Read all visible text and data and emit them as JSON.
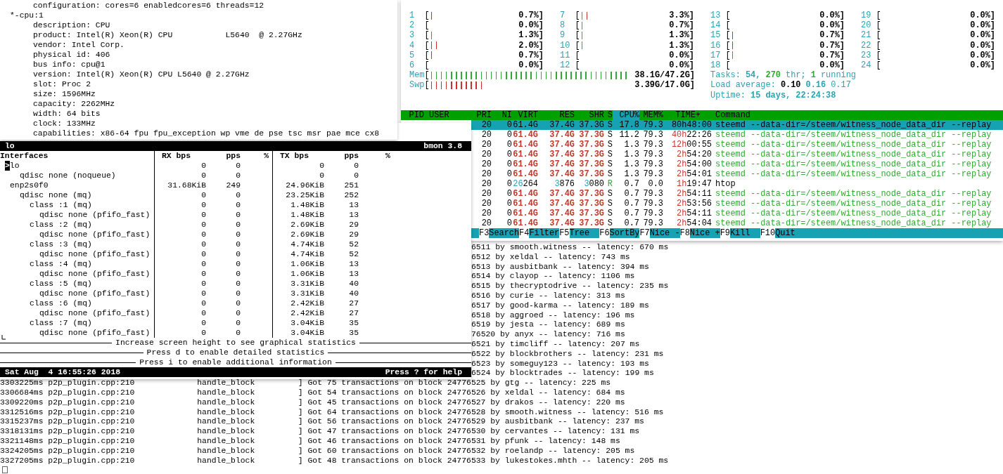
{
  "lshw": {
    "leading_line": "configuration: cores=6 enabledcores=6 threads=12",
    "node": {
      "name": "*-cpu:1",
      "properties": [
        "description: CPU",
        "product: Intel(R) Xeon(R) CPU           L5640  @ 2.27GHz",
        "vendor: Intel Corp.",
        "physical id: 406",
        "bus info: cpu@1",
        "version: Intel(R) Xeon(R) CPU L5640 @ 2.27GHz",
        "slot: Proc 2",
        "size: 1596MHz",
        "capacity: 2262MHz",
        "width: 64 bits",
        "clock: 133MHz",
        "capabilities: x86-64 fpu fpu_exception wp vme de pse tsc msr pae mce cx8"
      ]
    }
  },
  "htop": {
    "cpu_columns": [
      [
        {
          "label": "1",
          "open": "[",
          "ticks": [
            {
              "color": "#c83232"
            }
          ],
          "value": "0.7%]"
        },
        {
          "label": "2",
          "open": "[",
          "value": "0.0%]"
        },
        {
          "label": "3",
          "open": "[",
          "ticks": [
            {
              "color": "#34a834"
            }
          ],
          "value": "1.3%]"
        },
        {
          "label": "4",
          "open": "[",
          "ticks": [
            {
              "color": "#c83232"
            },
            {
              "color": "#c83232"
            }
          ],
          "value": "2.0%]"
        },
        {
          "label": "5",
          "open": "[",
          "ticks": [
            {
              "color": "#c83232"
            }
          ],
          "value": "0.7%]"
        },
        {
          "label": "6",
          "open": "[",
          "value": "0.0%]"
        }
      ],
      [
        {
          "label": "7",
          "open": "[",
          "ticks": [
            {
              "color": "#34a834"
            },
            {
              "color": "#c83232"
            }
          ],
          "value": "3.3%]"
        },
        {
          "label": "8",
          "open": "[",
          "ticks": [
            {
              "color": "#34a834"
            }
          ],
          "value": "0.7%]"
        },
        {
          "label": "9",
          "open": "[",
          "ticks": [
            {
              "color": "#34a834"
            }
          ],
          "value": "1.3%]"
        },
        {
          "label": "10",
          "open": "[",
          "ticks": [
            {
              "color": "#34a834"
            }
          ],
          "value": "1.3%]"
        },
        {
          "label": "11",
          "open": "[",
          "value": "0.0%]"
        },
        {
          "label": "12",
          "open": "[",
          "value": "0.0%]"
        }
      ],
      [
        {
          "label": "13",
          "open": "[",
          "value": "0.0%]"
        },
        {
          "label": "14",
          "open": "[",
          "value": "0.0%]"
        },
        {
          "label": "15",
          "open": "[",
          "ticks": [
            {
              "color": "#c83232"
            }
          ],
          "value": "0.7%]"
        },
        {
          "label": "16",
          "open": "[",
          "ticks": [
            {
              "color": "#c83232"
            }
          ],
          "value": "0.7%]"
        },
        {
          "label": "17",
          "open": "[",
          "ticks": [
            {
              "color": "#34a834"
            }
          ],
          "value": "0.7%]"
        },
        {
          "label": "18",
          "open": "[",
          "value": "0.0%]"
        }
      ],
      [
        {
          "label": "19",
          "open": "[",
          "value": "0.0%]"
        },
        {
          "label": "20",
          "open": "[",
          "value": "0.0%]"
        },
        {
          "label": "21",
          "open": "[",
          "value": "0.0%]"
        },
        {
          "label": "22",
          "open": "[",
          "value": "0.0%]"
        },
        {
          "label": "23",
          "open": "[",
          "value": "0.0%]"
        },
        {
          "label": "24",
          "open": "[",
          "value": "0.0%]"
        }
      ]
    ],
    "memory": [
      {
        "label": "Mem",
        "open": "[",
        "ticks": [
          {
            "color": "#34a834"
          },
          {
            "color": "#34a834"
          },
          {
            "color": "#34a834"
          },
          {
            "color": "#34a834"
          },
          {
            "color": "#34a834"
          },
          {
            "color": "#34a834"
          },
          {
            "color": "#34a834"
          },
          {
            "color": "#34a834"
          },
          {
            "color": "#34a834"
          },
          {
            "color": "#34a834"
          },
          {
            "color": "#34a834"
          },
          {
            "color": "#34a834"
          },
          {
            "color": "#34a834"
          },
          {
            "color": "#34a834"
          },
          {
            "color": "#34a834"
          },
          {
            "color": "#34a834"
          },
          {
            "color": "#34a834"
          },
          {
            "color": "#34a834"
          },
          {
            "color": "#34a834"
          },
          {
            "color": "#34a834"
          },
          {
            "color": "#34a834"
          },
          {
            "color": "#34a834"
          },
          {
            "color": "#34a834"
          },
          {
            "color": "#34a834"
          },
          {
            "color": "#34a834"
          },
          {
            "color": "#34a834"
          },
          {
            "color": "#34a834"
          },
          {
            "color": "#34a834"
          },
          {
            "color": "#34a834"
          },
          {
            "color": "#34a834"
          },
          {
            "color": "#34a834"
          },
          {
            "color": "#34a834"
          },
          {
            "color": "#34a834"
          },
          {
            "color": "#34a834"
          },
          {
            "color": "#34a834"
          },
          {
            "color": "#34a834"
          },
          {
            "color": "#34a834"
          },
          {
            "color": "#34a834"
          },
          {
            "color": "#34a834"
          },
          {
            "color": "#34a834"
          }
        ],
        "value": "38.1G/47.2G]"
      },
      {
        "label": "Swp",
        "open": "[",
        "ticks": [
          {
            "color": "#c83232"
          },
          {
            "color": "#c83232"
          },
          {
            "color": "#c83232"
          },
          {
            "color": "#c83232"
          },
          {
            "color": "#c83232"
          },
          {
            "color": "#c83232"
          },
          {
            "color": "#c83232"
          },
          {
            "color": "#c83232"
          },
          {
            "color": "#c83232"
          },
          {
            "color": "#c83232"
          },
          {
            "color": "#c83232"
          }
        ],
        "value": "3.39G/17.0G]"
      }
    ],
    "info": [
      [
        {
          "text": "Tasks:",
          "kind": "label"
        },
        {
          "text": "54,",
          "kind": "value"
        },
        {
          "text": "270",
          "kind": "highlight"
        },
        {
          "text": "thr;",
          "kind": "label"
        },
        {
          "text": "1",
          "kind": "highlight"
        },
        {
          "text": "running",
          "kind": "label"
        }
      ],
      [
        {
          "text": "Load average:",
          "kind": "label"
        },
        {
          "text": "0.10",
          "kind": "strong"
        },
        {
          "text": "0.16",
          "kind": "value"
        },
        {
          "text": "0.17",
          "kind": "label"
        }
      ],
      [
        {
          "text": "Uptime:",
          "kind": "label"
        },
        {
          "text": "15 days, 22:24:38",
          "kind": "value"
        }
      ]
    ],
    "columns": [
      {
        "label": "PID",
        "sorted": false
      },
      {
        "label": "USER",
        "sorted": false
      },
      {
        "label": "PRI",
        "sorted": false
      },
      {
        "label": "NI",
        "sorted": false
      },
      {
        "label": "VIRT",
        "sorted": false
      },
      {
        "label": "RES",
        "sorted": false
      },
      {
        "label": "SHR",
        "sorted": false
      },
      {
        "label": "S",
        "sorted": false
      },
      {
        "label": "CPU%",
        "sorted": true
      },
      {
        "label": "MEM%",
        "sorted": false
      },
      {
        "label": "TIME+",
        "sorted": false
      },
      {
        "label": "Command",
        "sorted": false
      }
    ],
    "processes": [
      {
        "selected": true,
        "kind": "thread",
        "large_memory": true,
        "running": false,
        "pri": "20",
        "ni": "0",
        "virt": {
          "hi": "61.4G"
        },
        "res": {
          "hi": "37.4G"
        },
        "shr": {
          "hi": "37.3G"
        },
        "state": "S",
        "cpu": "17.8",
        "mem": "79.3",
        "time": {
          "hi": "80h",
          "lo": "48:00"
        },
        "command": "steemd --data-dir=/steem/witness_node_data_dir --replay"
      },
      {
        "selected": false,
        "kind": "thread",
        "large_memory": true,
        "running": false,
        "pri": "20",
        "ni": "0",
        "virt": {
          "hi": "61.4G"
        },
        "res": {
          "hi": "37.4G"
        },
        "shr": {
          "hi": "37.3G"
        },
        "state": "S",
        "cpu": "11.2",
        "mem": "79.3",
        "time": {
          "hi": "40h",
          "lo": "22:26"
        },
        "command": "steemd --data-dir=/steem/witness_node_data_dir --replay"
      },
      {
        "selected": false,
        "kind": "thread",
        "large_memory": true,
        "running": false,
        "pri": "20",
        "ni": "0",
        "virt": {
          "hi": "61.4G"
        },
        "res": {
          "hi": "37.4G"
        },
        "shr": {
          "hi": "37.3G"
        },
        "state": "S",
        "cpu": "1.3",
        "mem": "79.3",
        "time": {
          "hi": "12h",
          "lo": "00:55"
        },
        "command": "steemd --data-dir=/steem/witness_node_data_dir --replay"
      },
      {
        "selected": false,
        "kind": "thread",
        "large_memory": true,
        "running": false,
        "pri": "20",
        "ni": "0",
        "virt": {
          "hi": "61.4G"
        },
        "res": {
          "hi": "37.4G"
        },
        "shr": {
          "hi": "37.3G"
        },
        "state": "S",
        "cpu": "1.3",
        "mem": "79.3",
        "time": {
          "hi": "2h",
          "lo": "54:20"
        },
        "command": "steemd --data-dir=/steem/witness_node_data_dir --replay"
      },
      {
        "selected": false,
        "kind": "thread",
        "large_memory": true,
        "running": false,
        "pri": "20",
        "ni": "0",
        "virt": {
          "hi": "61.4G"
        },
        "res": {
          "hi": "37.4G"
        },
        "shr": {
          "hi": "37.3G"
        },
        "state": "S",
        "cpu": "1.3",
        "mem": "79.3",
        "time": {
          "hi": "2h",
          "lo": "54:00"
        },
        "command": "steemd --data-dir=/steem/witness_node_data_dir --replay"
      },
      {
        "selected": false,
        "kind": "thread",
        "large_memory": true,
        "running": false,
        "pri": "20",
        "ni": "0",
        "virt": {
          "hi": "61.4G"
        },
        "res": {
          "hi": "37.4G"
        },
        "shr": {
          "hi": "37.3G"
        },
        "state": "S",
        "cpu": "1.3",
        "mem": "79.3",
        "time": {
          "hi": "2h",
          "lo": "54:01"
        },
        "command": "steemd --data-dir=/steem/witness_node_data_dir --replay"
      },
      {
        "selected": false,
        "kind": "process",
        "large_memory": false,
        "running": true,
        "pri": "20",
        "ni": "0",
        "virt": {
          "hi": "26",
          "lo": "264"
        },
        "res": {
          "hi": "3",
          "lo": "876"
        },
        "shr": {
          "hi": "3",
          "lo": "080"
        },
        "state": "R",
        "cpu": "0.7",
        "mem": "0.0",
        "time": {
          "hi": "1h",
          "lo": "19:47"
        },
        "command": "htop"
      },
      {
        "selected": false,
        "kind": "thread",
        "large_memory": true,
        "running": false,
        "pri": "20",
        "ni": "0",
        "virt": {
          "hi": "61.4G"
        },
        "res": {
          "hi": "37.4G"
        },
        "shr": {
          "hi": "37.3G"
        },
        "state": "S",
        "cpu": "0.7",
        "mem": "79.3",
        "time": {
          "hi": "2h",
          "lo": "54:11"
        },
        "command": "steemd --data-dir=/steem/witness_node_data_dir --replay"
      },
      {
        "selected": false,
        "kind": "thread",
        "large_memory": true,
        "running": false,
        "pri": "20",
        "ni": "0",
        "virt": {
          "hi": "61.4G"
        },
        "res": {
          "hi": "37.4G"
        },
        "shr": {
          "hi": "37.3G"
        },
        "state": "S",
        "cpu": "0.7",
        "mem": "79.3",
        "time": {
          "hi": "2h",
          "lo": "53:56"
        },
        "command": "steemd --data-dir=/steem/witness_node_data_dir --replay"
      },
      {
        "selected": false,
        "kind": "thread",
        "large_memory": true,
        "running": false,
        "pri": "20",
        "ni": "0",
        "virt": {
          "hi": "61.4G"
        },
        "res": {
          "hi": "37.4G"
        },
        "shr": {
          "hi": "37.3G"
        },
        "state": "S",
        "cpu": "0.7",
        "mem": "79.3",
        "time": {
          "hi": "2h",
          "lo": "54:11"
        },
        "command": "steemd --data-dir=/steem/witness_node_data_dir --replay"
      },
      {
        "selected": false,
        "kind": "thread",
        "large_memory": true,
        "running": false,
        "pri": "20",
        "ni": "0",
        "virt": {
          "hi": "61.4G"
        },
        "res": {
          "hi": "37.4G"
        },
        "shr": {
          "hi": "37.3G"
        },
        "state": "S",
        "cpu": "0.7",
        "mem": "79.3",
        "time": {
          "hi": "2h",
          "lo": "54:04"
        },
        "command": "steemd --data-dir=/steem/witness_node_data_dir --replay"
      }
    ],
    "function_keys": [
      {
        "key": "F3",
        "label": "Search"
      },
      {
        "key": "F4",
        "label": "Filter"
      },
      {
        "key": "F5",
        "label": "Tree"
      },
      {
        "key": "F6",
        "label": "SortBy"
      },
      {
        "key": "F7",
        "label": "Nice -"
      },
      {
        "key": "F8",
        "label": "Nice +"
      },
      {
        "key": "F9",
        "label": "Kill"
      },
      {
        "key": "F10",
        "label": "Quit"
      }
    ]
  },
  "bmon": {
    "title": "lo",
    "version": "bmon 3.8",
    "marker": ">",
    "headers": {
      "interfaces": "Interfaces",
      "rx_bps": "RX bps",
      "rx_pps": "pps",
      "rx_pct": "%",
      "tx_bps": "TX bps",
      "tx_pps": "pps",
      "tx_pct": "%"
    },
    "interfaces": [
      {
        "name": "lo",
        "selected": true,
        "rx_bps": "0",
        "rx_pps": "0",
        "tx_bps": "0",
        "tx_pps": "0",
        "children": [
          {
            "name": "qdisc none (noqueue)",
            "selected": false,
            "rx_bps": "0",
            "rx_pps": "0",
            "tx_bps": "0",
            "tx_pps": "0"
          }
        ]
      },
      {
        "name": "enp2s0f0",
        "selected": false,
        "rx_bps": "31.68KiB",
        "rx_pps": "249",
        "tx_bps": "24.96KiB",
        "tx_pps": "251",
        "children": [
          {
            "name": "qdisc none (mq)",
            "selected": false,
            "rx_bps": "0",
            "rx_pps": "0",
            "tx_bps": "23.25KiB",
            "tx_pps": "252",
            "children": [
              {
                "name": "class :1 (mq)",
                "selected": false,
                "rx_bps": "0",
                "rx_pps": "0",
                "tx_bps": "1.48KiB",
                "tx_pps": "13",
                "children": [
                  {
                    "name": "qdisc none (pfifo_fast)",
                    "selected": false,
                    "rx_bps": "0",
                    "rx_pps": "0",
                    "tx_bps": "1.48KiB",
                    "tx_pps": "13"
                  }
                ]
              },
              {
                "name": "class :2 (mq)",
                "selected": false,
                "rx_bps": "0",
                "rx_pps": "0",
                "tx_bps": "2.69KiB",
                "tx_pps": "29",
                "children": [
                  {
                    "name": "qdisc none (pfifo_fast)",
                    "selected": false,
                    "rx_bps": "0",
                    "rx_pps": "0",
                    "tx_bps": "2.69KiB",
                    "tx_pps": "29"
                  }
                ]
              },
              {
                "name": "class :3 (mq)",
                "selected": false,
                "rx_bps": "0",
                "rx_pps": "0",
                "tx_bps": "4.74KiB",
                "tx_pps": "52",
                "children": [
                  {
                    "name": "qdisc none (pfifo_fast)",
                    "selected": false,
                    "rx_bps": "0",
                    "rx_pps": "0",
                    "tx_bps": "4.74KiB",
                    "tx_pps": "52"
                  }
                ]
              },
              {
                "name": "class :4 (mq)",
                "selected": false,
                "rx_bps": "0",
                "rx_pps": "0",
                "tx_bps": "1.06KiB",
                "tx_pps": "13",
                "children": [
                  {
                    "name": "qdisc none (pfifo_fast)",
                    "selected": false,
                    "rx_bps": "0",
                    "rx_pps": "0",
                    "tx_bps": "1.06KiB",
                    "tx_pps": "13"
                  }
                ]
              },
              {
                "name": "class :5 (mq)",
                "selected": false,
                "rx_bps": "0",
                "rx_pps": "0",
                "tx_bps": "3.31KiB",
                "tx_pps": "40",
                "children": [
                  {
                    "name": "qdisc none (pfifo_fast)",
                    "selected": false,
                    "rx_bps": "0",
                    "rx_pps": "0",
                    "tx_bps": "3.31KiB",
                    "tx_pps": "40"
                  }
                ]
              },
              {
                "name": "class :6 (mq)",
                "selected": false,
                "rx_bps": "0",
                "rx_pps": "0",
                "tx_bps": "2.42KiB",
                "tx_pps": "27",
                "children": [
                  {
                    "name": "qdisc none (pfifo_fast)",
                    "selected": false,
                    "rx_bps": "0",
                    "rx_pps": "0",
                    "tx_bps": "2.42KiB",
                    "tx_pps": "27"
                  }
                ]
              },
              {
                "name": "class :7 (mq)",
                "selected": false,
                "rx_bps": "0",
                "rx_pps": "0",
                "tx_bps": "3.04KiB",
                "tx_pps": "35",
                "children": [
                  {
                    "name": "qdisc none (pfifo_fast)",
                    "selected": false,
                    "rx_bps": "0",
                    "rx_pps": "0",
                    "tx_bps": "3.04KiB",
                    "tx_pps": "35"
                  }
                ]
              }
            ]
          }
        ]
      }
    ],
    "messages": [
      "Increase screen height to see graphical statistics",
      "Press d to enable detailed statistics",
      "Press i to enable additional information"
    ],
    "clock": "Sat Aug  4 16:55:26 2018",
    "help": "Press ? for help"
  },
  "log": {
    "partial_lines": [
      "6511 by smooth.witness -- latency: 670 ms",
      "6512 by xeldal -- latency: 743 ms",
      "6513 by ausbitbank -- latency: 394 ms",
      "6514 by clayop -- latency: 1106 ms",
      "6515 by thecryptodrive -- latency: 235 ms",
      "6516 by curie -- latency: 313 ms",
      "6517 by good-karma -- latency: 189 ms",
      "6518 by aggroed -- latency: 196 ms",
      "6519 by jesta -- latency: 689 ms",
      "76520 by anyx -- latency: 716 ms",
      "6521 by timcliff -- latency: 207 ms",
      "6522 by blockbrothers -- latency: 231 ms",
      "6523 by someguy123 -- latency: 193 ms",
      "6524 by blocktrades -- latency: 199 ms"
    ],
    "lines": [
      "3303225ms p2p_plugin.cpp:210             handle_block         ] Got 75 transactions on block 24776525 by gtg -- latency: 225 ms",
      "3306684ms p2p_plugin.cpp:210             handle_block         ] Got 54 transactions on block 24776526 by xeldal -- latency: 684 ms",
      "3309220ms p2p_plugin.cpp:210             handle_block         ] Got 45 transactions on block 24776527 by drakos -- latency: 220 ms",
      "3312516ms p2p_plugin.cpp:210             handle_block         ] Got 64 transactions on block 24776528 by smooth.witness -- latency: 516 ms",
      "3315237ms p2p_plugin.cpp:210             handle_block         ] Got 56 transactions on block 24776529 by ausbitbank -- latency: 237 ms",
      "3318131ms p2p_plugin.cpp:210             handle_block         ] Got 47 transactions on block 24776530 by cervantes -- latency: 131 ms",
      "3321148ms p2p_plugin.cpp:210             handle_block         ] Got 46 transactions on block 24776531 by pfunk -- latency: 148 ms",
      "3324205ms p2p_plugin.cpp:210             handle_block         ] Got 60 transactions on block 24776532 by roelandp -- latency: 205 ms",
      "3327205ms p2p_plugin.cpp:210             handle_block         ] Got 48 transactions on block 24776533 by lukestokes.mhth -- latency: 205 ms"
    ]
  }
}
